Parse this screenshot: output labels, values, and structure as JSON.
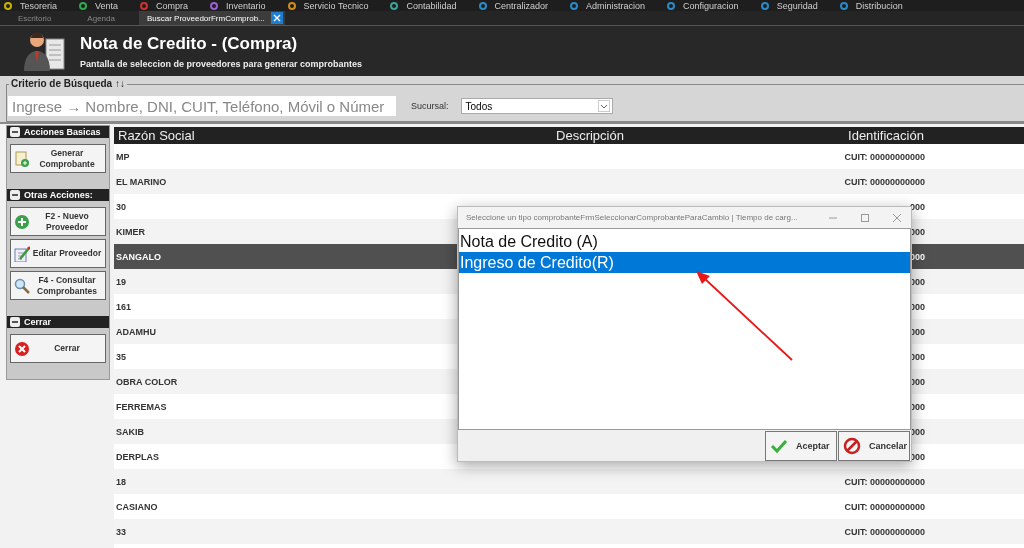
{
  "menu": [
    {
      "label": "Tesoreria",
      "color": "#c8b400"
    },
    {
      "label": "Venta",
      "color": "#2fa84f"
    },
    {
      "label": "Compra",
      "color": "#d03030"
    },
    {
      "label": "Inventario",
      "color": "#9a5fd0"
    },
    {
      "label": "Servicio Tecnico",
      "color": "#d08a20"
    },
    {
      "label": "Contabilidad",
      "color": "#3aa39a"
    },
    {
      "label": "Centralizador",
      "color": "#2a8ac8"
    },
    {
      "label": "Administracion",
      "color": "#2a8ac8"
    },
    {
      "label": "Configuracion",
      "color": "#2a8ac8"
    },
    {
      "label": "Seguridad",
      "color": "#2a8ac8"
    },
    {
      "label": "Distribucion",
      "color": "#2a8ac8"
    }
  ],
  "tabs": [
    {
      "label": "Escritorio",
      "selected": false
    },
    {
      "label": "Agenda",
      "selected": false
    },
    {
      "label": "Buscar ProveedorFrmComprob...",
      "selected": true
    }
  ],
  "header": {
    "title": "Nota de Credito - (Compra)",
    "subtitle": "Pantalla de seleccion de proveedores para generar comprobantes"
  },
  "search": {
    "legend": "Criterio de Búsqueda ↑↓",
    "placeholder": "Ingrese → Nombre, DNI, CUIT, Teléfono, Móvil o Númer",
    "branch_label": "Sucursal:",
    "branch_value": "Todos"
  },
  "sidebar": {
    "groups": [
      {
        "title": "Acciones Basicas",
        "buttons": [
          {
            "label": "Generar Comprobante"
          }
        ]
      },
      {
        "title": "Otras Acciones:",
        "buttons": [
          {
            "label": "F2 - Nuevo Proveedor"
          },
          {
            "label": "Editar Proveedor"
          },
          {
            "label": "F4 - Consultar Comprobantes"
          }
        ]
      },
      {
        "title": "Cerrar",
        "buttons": [
          {
            "label": "Cerrar"
          }
        ]
      }
    ]
  },
  "table": {
    "columns": [
      "Razón Social",
      "Descripción",
      "Identificación"
    ],
    "rows": [
      {
        "name": "MP",
        "id": "CUIT: 00000000000",
        "selected": false
      },
      {
        "name": "EL MARINO",
        "id": "CUIT: 00000000000",
        "selected": false
      },
      {
        "name": "30",
        "id": "000",
        "selected": false
      },
      {
        "name": "KIMER",
        "id": "000",
        "selected": false
      },
      {
        "name": "SANGALO",
        "id": "000",
        "selected": true
      },
      {
        "name": "19",
        "id": "000",
        "selected": false
      },
      {
        "name": "161",
        "id": "000",
        "selected": false
      },
      {
        "name": "ADAMHU",
        "id": "000",
        "selected": false
      },
      {
        "name": "35",
        "id": "000",
        "selected": false
      },
      {
        "name": "OBRA COLOR",
        "id": "000",
        "selected": false
      },
      {
        "name": "FERREMAS",
        "id": "000",
        "selected": false
      },
      {
        "name": "SAKIB",
        "id": "000",
        "selected": false
      },
      {
        "name": "DERPLAS",
        "id": "000",
        "selected": false
      },
      {
        "name": "18",
        "id": "CUIT: 00000000000",
        "selected": false
      },
      {
        "name": "CASIANO",
        "id": "CUIT: 00000000000",
        "selected": false
      },
      {
        "name": "33",
        "id": "CUIT: 00000000000",
        "selected": false
      }
    ]
  },
  "dialog": {
    "title": "Seleccione un tipo comprobanteFrmSeleccionarComprobanteParaCambio | Tiempo de carg...",
    "items": [
      {
        "label": "Nota de Credito (A)",
        "selected": false
      },
      {
        "label": "Ingreso de Credito(R)",
        "selected": true
      }
    ],
    "buttons": [
      {
        "label": "Aceptar",
        "kind": "accept"
      },
      {
        "label": "Cancelar",
        "kind": "cancel"
      }
    ]
  }
}
